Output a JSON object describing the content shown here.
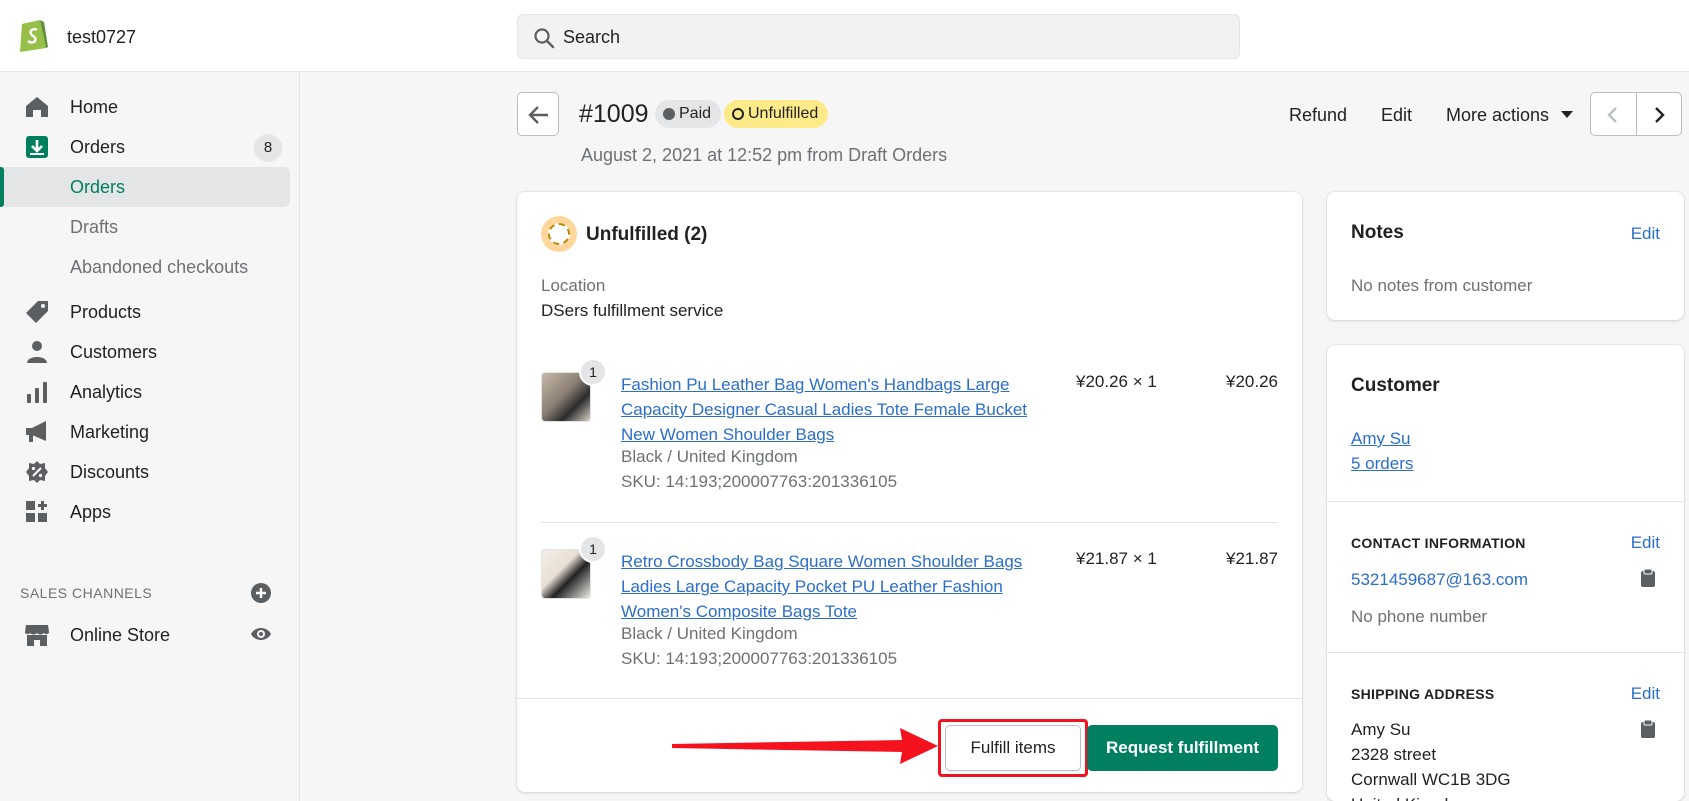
{
  "topbar": {
    "store_name": "test0727",
    "search_placeholder": "Search"
  },
  "sidebar": {
    "home": "Home",
    "orders": "Orders",
    "orders_count": "8",
    "sub_orders": "Orders",
    "drafts": "Drafts",
    "abandoned": "Abandoned checkouts",
    "products": "Products",
    "customers": "Customers",
    "analytics": "Analytics",
    "marketing": "Marketing",
    "discounts": "Discounts",
    "apps": "Apps",
    "sales_channels": "SALES CHANNELS",
    "online_store": "Online Store"
  },
  "order": {
    "number": "#1009",
    "paid_badge": "Paid",
    "fulfillment_badge": "Unfulfilled",
    "date": "August 2, 2021 at 12:52 pm from Draft Orders",
    "refund": "Refund",
    "edit": "Edit",
    "more_actions": "More actions"
  },
  "fulfillment": {
    "title": "Unfulfilled (2)",
    "location_label": "Location",
    "location_value": "DSers fulfillment service",
    "items": [
      {
        "qty": "1",
        "name": "Fashion Pu Leather Bag Women's Handbags Large Capacity Designer Casual Ladies Tote Female Bucket New Women Shoulder Bags",
        "variant": "Black / United Kingdom",
        "sku": "SKU: 14:193;200007763:201336105",
        "unit": "¥20.26 × 1",
        "total": "¥20.26"
      },
      {
        "qty": "1",
        "name": "Retro Crossbody Bag Square Women Shoulder Bags Ladies Large Capacity Pocket PU Leather Fashion Women's Composite Bags Tote",
        "variant": "Black / United Kingdom",
        "sku": "SKU: 14:193;200007763:201336105",
        "unit": "¥21.87 × 1",
        "total": "¥21.87"
      }
    ],
    "fulfill_button": "Fulfill items",
    "request_button": "Request fulfillment"
  },
  "notes": {
    "title": "Notes",
    "edit": "Edit",
    "text": "No notes from customer"
  },
  "customer": {
    "title": "Customer",
    "name": "Amy Su",
    "orders": "5 orders",
    "contact_heading": "CONTACT INFORMATION",
    "contact_edit": "Edit",
    "email": "5321459687@163.com",
    "phone": "No phone number",
    "shipping_heading": "SHIPPING ADDRESS",
    "shipping_edit": "Edit",
    "addr_name": "Amy Su",
    "addr_street": "2328 street",
    "addr_city": "Cornwall WC1B 3DG",
    "addr_country": "United Kingdom"
  },
  "colors": {
    "accent": "#008060",
    "link": "#2c6ecb",
    "highlight": "#f5121f",
    "unfulfilled_badge": "#ffea8a"
  }
}
